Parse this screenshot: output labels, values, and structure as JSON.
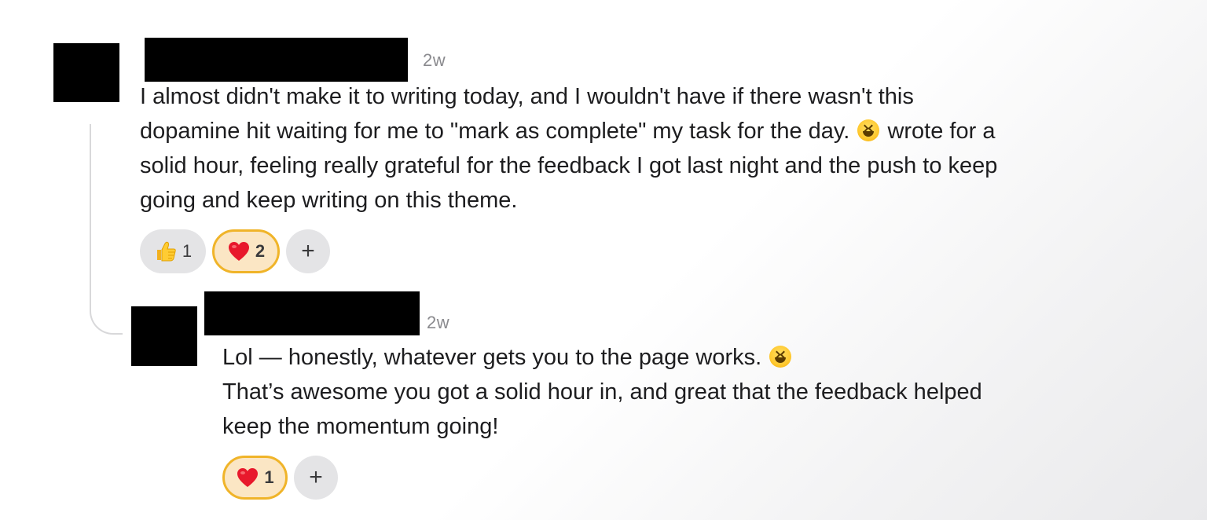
{
  "comments": [
    {
      "timestamp": "2w",
      "lines": [
        "I almost didn't make it to writing today, and I wouldn't have if there wasn't this",
        "dopamine hit waiting for me to \"mark as complete\" my task for the day.",
        " wrote for a",
        "solid hour, feeling really grateful for the feedback I got last night and the push to keep",
        "going and keep writing on this theme."
      ],
      "reactions": [
        {
          "icon": "thumbs-up-icon",
          "count": "1",
          "active": false
        },
        {
          "icon": "heart-icon",
          "count": "2",
          "active": true
        }
      ],
      "add_reaction_label": "+"
    },
    {
      "timestamp": "2w",
      "lines": [
        "Lol — honestly, whatever gets you to the page works.",
        "That’s awesome you got a solid hour in, and great that the feedback helped",
        "keep the momentum going!"
      ],
      "reactions": [
        {
          "icon": "heart-icon",
          "count": "1",
          "active": true
        }
      ],
      "add_reaction_label": "+"
    }
  ],
  "colors": {
    "active_reaction_bg": "#fbe6c4",
    "active_reaction_border": "#f0b429",
    "reaction_bg": "#e4e4e6",
    "text": "#1d1d1f",
    "muted": "#8a8a8e"
  }
}
